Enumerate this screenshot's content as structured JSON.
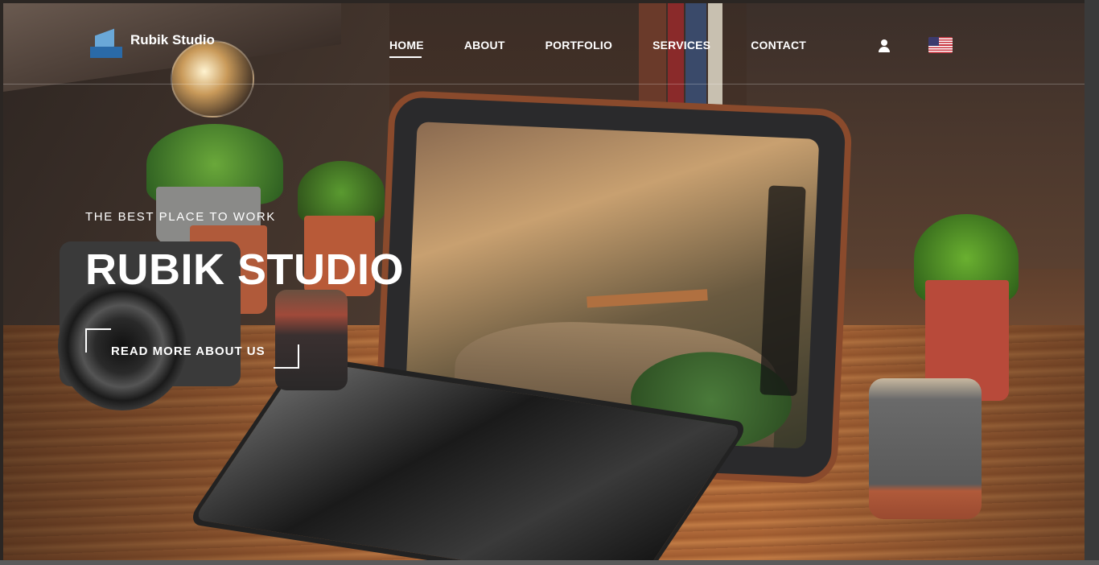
{
  "header": {
    "logo_text": "Rubik Studio",
    "nav": [
      {
        "label": "HOME",
        "active": true
      },
      {
        "label": "ABOUT",
        "active": false
      },
      {
        "label": "PORTFOLIO",
        "active": false
      },
      {
        "label": "SERVICES",
        "active": false
      },
      {
        "label": "CONTACT",
        "active": false
      }
    ],
    "icons": {
      "account": "user-icon",
      "language": "us-flag-icon"
    }
  },
  "hero": {
    "tagline": "THE BEST PLACE TO WORK",
    "title": "RUBIK STUDIO",
    "cta_label": "READ MORE ABOUT US"
  },
  "colors": {
    "text": "#ffffff",
    "logo_cube_light": "#6aa8d8",
    "logo_cube_dark": "#2a6aa8"
  }
}
